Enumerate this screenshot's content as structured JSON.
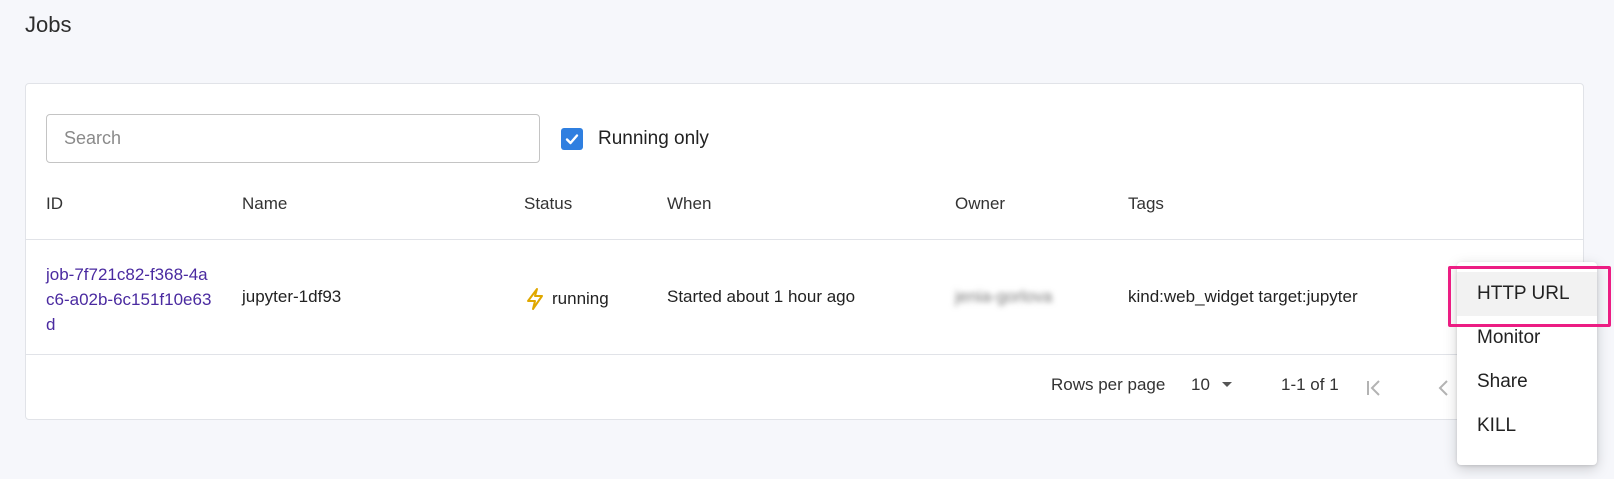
{
  "page": {
    "title": "Jobs"
  },
  "toolbar": {
    "search_placeholder": "Search",
    "search_value": "",
    "running_only_label": "Running only",
    "running_only_checked": true
  },
  "table": {
    "columns": [
      "ID",
      "Name",
      "Status",
      "When",
      "Owner",
      "Tags"
    ],
    "rows": [
      {
        "id": "job-7f721c82-f368-4ac6-a02b-6c151f10e63d",
        "name": "jupyter-1df93",
        "status": "running",
        "status_icon": "lightning-bolt-icon",
        "when": "Started about 1 hour ago",
        "owner": "jenia-gorlova",
        "owner_blurred": true,
        "tags": "kind:web_widget target:jupyter"
      }
    ]
  },
  "pagination": {
    "rows_per_page_label": "Rows per page",
    "rows_per_page_value": "10",
    "range_label": "1-1 of 1"
  },
  "action_menu": {
    "items": [
      {
        "label": "HTTP URL",
        "highlighted": true
      },
      {
        "label": "Monitor"
      },
      {
        "label": "Share"
      },
      {
        "label": "KILL"
      }
    ]
  },
  "colors": {
    "accent": "#2f7fe0",
    "link": "#4a2aa0",
    "status_icon": "#e0a800",
    "highlight": "#ec1d83"
  }
}
